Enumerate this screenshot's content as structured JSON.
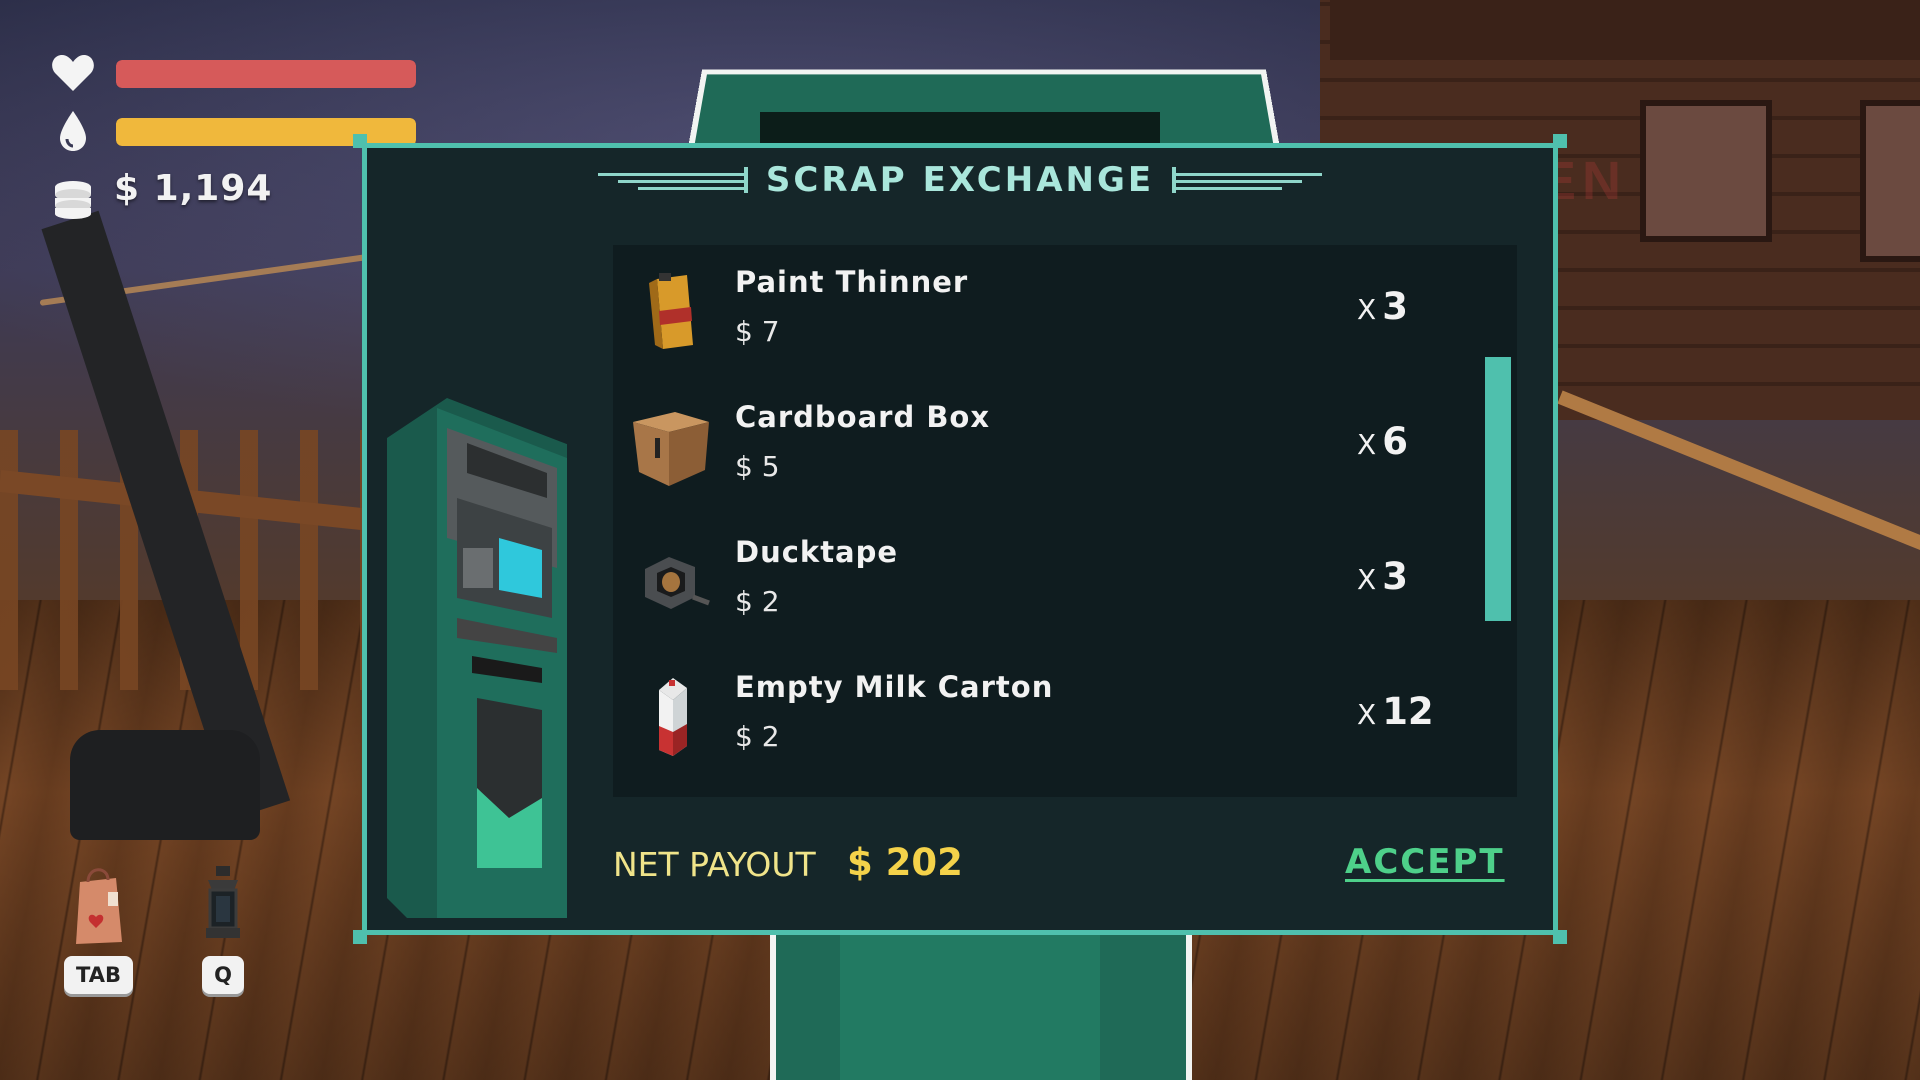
{
  "hud": {
    "health": {
      "icon": "heart-icon",
      "level": 1.0,
      "color": "#d65a5a"
    },
    "thirst": {
      "icon": "water-drop-icon",
      "level": 1.0,
      "color": "#f0b83c"
    },
    "money": {
      "icon": "coins-stack-icon",
      "amount": "$ 1,194"
    }
  },
  "hotkeys": [
    {
      "icon": "shopping-bag-icon",
      "key": "TAB"
    },
    {
      "icon": "lantern-icon",
      "key": "Q"
    }
  ],
  "exchange": {
    "title": "SCRAP EXCHANGE",
    "items": [
      {
        "name": "Paint Thinner",
        "price": "$ 7",
        "qty_prefix": "X",
        "qty": "3",
        "icon": "paint-thinner-can-icon"
      },
      {
        "name": "Cardboard Box",
        "price": "$ 5",
        "qty_prefix": "X",
        "qty": "6",
        "icon": "cardboard-box-icon"
      },
      {
        "name": "Ducktape",
        "price": "$ 2",
        "qty_prefix": "X",
        "qty": "3",
        "icon": "ducktape-icon"
      },
      {
        "name": "Empty Milk Carton",
        "price": "$ 2",
        "qty_prefix": "X",
        "qty": "12",
        "icon": "milk-carton-icon"
      }
    ],
    "payout_label": "NET PAYOUT",
    "payout_value": "$ 202",
    "accept_label": "ACCEPT"
  },
  "colors": {
    "panel_bg": "#152629",
    "accent": "#4fc0ad",
    "payout_label": "#f0e48a",
    "payout_value": "#f4d24a",
    "accept": "#4ed08a"
  }
}
